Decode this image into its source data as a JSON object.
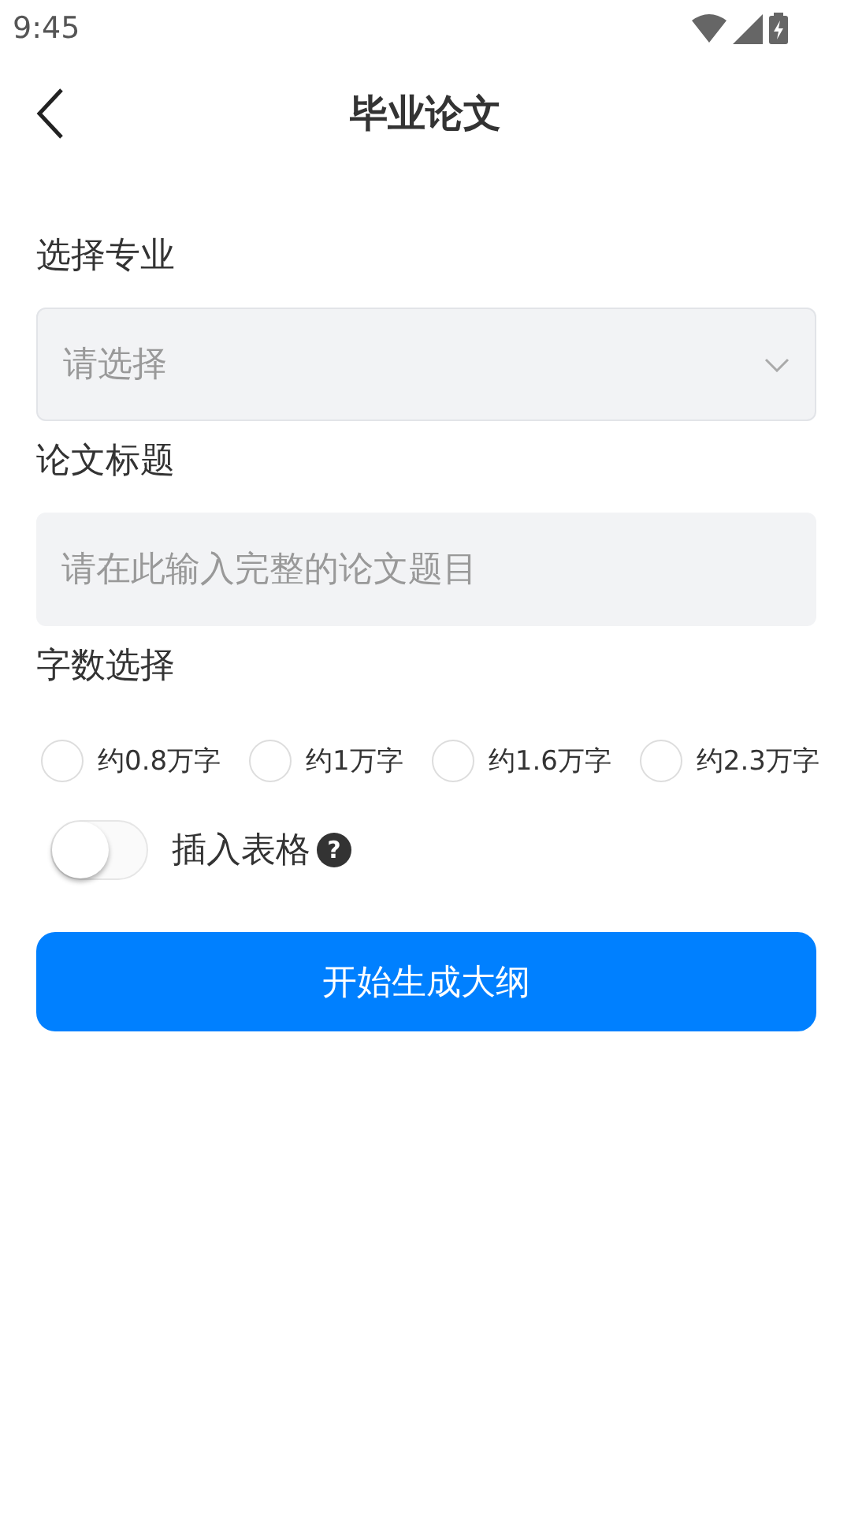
{
  "status_bar": {
    "time": "9:45"
  },
  "header": {
    "title": "毕业论文"
  },
  "major": {
    "label": "选择专业",
    "placeholder": "请选择"
  },
  "paper_title": {
    "label": "论文标题",
    "placeholder": "请在此输入完整的论文题目"
  },
  "word_count": {
    "label": "字数选择",
    "options": [
      {
        "label": "约0.8万字",
        "selected": false
      },
      {
        "label": "约1万字",
        "selected": false
      },
      {
        "label": "约1.6万字",
        "selected": false
      },
      {
        "label": "约2.3万字",
        "selected": false
      }
    ]
  },
  "insert_table": {
    "label": "插入表格",
    "on": false,
    "help": "?"
  },
  "submit_button": {
    "label": "开始生成大纲"
  }
}
